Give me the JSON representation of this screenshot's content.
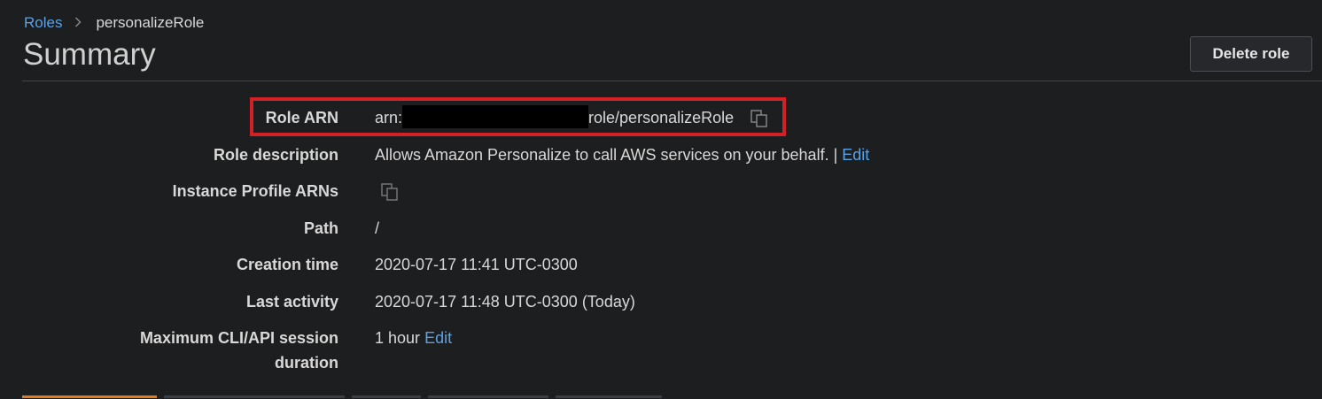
{
  "breadcrumb": {
    "parent": "Roles",
    "separator": ">",
    "current": "personalizeRole"
  },
  "header": {
    "title": "Summary",
    "delete_label": "Delete role"
  },
  "summary": {
    "role_arn": {
      "label": "Role ARN",
      "prefix": "arn:",
      "suffix": "role/personalizeRole"
    },
    "role_description": {
      "label": "Role description",
      "value": "Allows Amazon Personalize to call AWS services on your behalf. |",
      "edit_label": "Edit"
    },
    "instance_profile_arns": {
      "label": "Instance Profile ARNs"
    },
    "path": {
      "label": "Path",
      "value": "/"
    },
    "creation_time": {
      "label": "Creation time",
      "value": "2020-07-17 11:41 UTC-0300"
    },
    "last_activity": {
      "label": "Last activity",
      "value": "2020-07-17 11:48 UTC-0300 (Today)"
    },
    "max_session": {
      "label_line1": "Maximum CLI/API session",
      "label_line2": "duration",
      "value": "1 hour",
      "edit_label": "Edit"
    }
  },
  "icons": {
    "copy": "copy-icon",
    "breadcrumb_separator": "chevron-right-icon"
  },
  "colors": {
    "background": "#1d1e20",
    "link": "#5aa2e6",
    "highlight": "#d22027",
    "active_tab": "#e5781b"
  }
}
